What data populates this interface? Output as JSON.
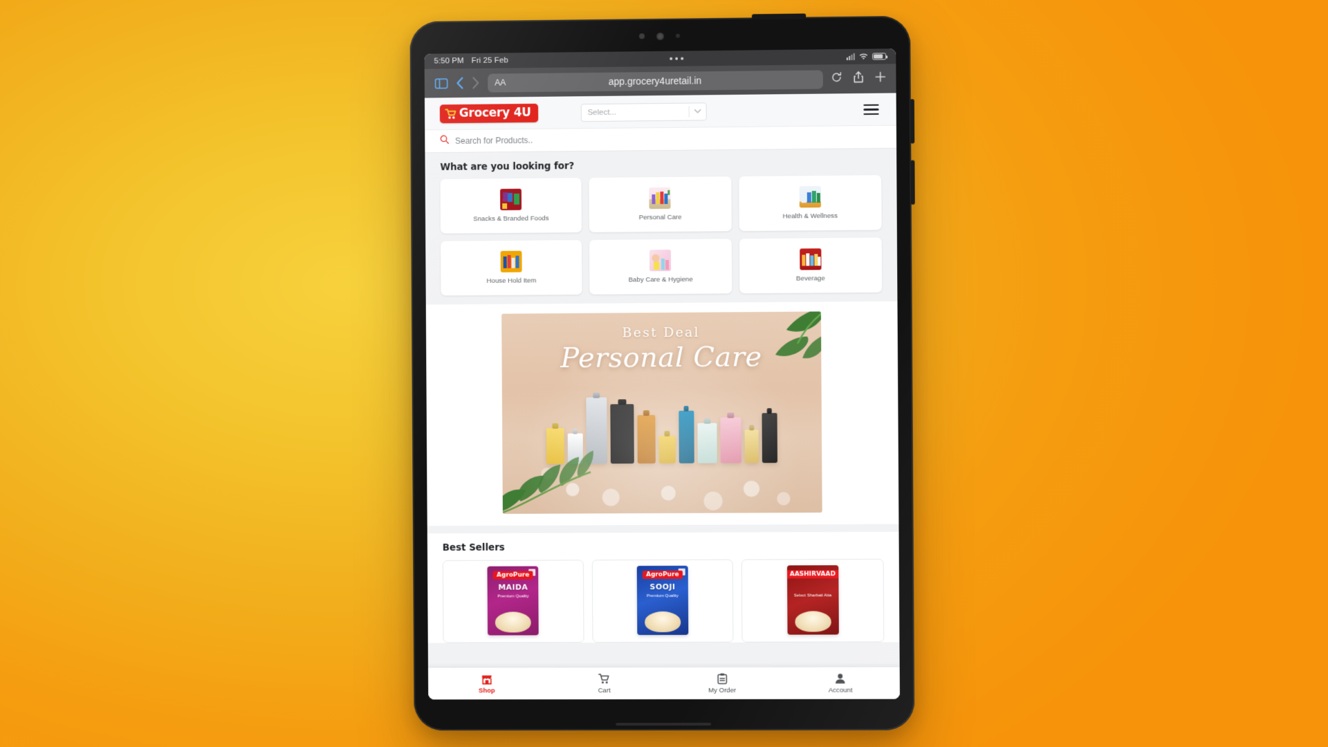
{
  "device": {
    "status_bar": {
      "time": "5:50 PM",
      "date": "Fri 25 Feb",
      "wifi_icon": "wifi-icon",
      "battery_icon": "battery-icon"
    },
    "browser": {
      "sidebar_icon": "sidebar-icon",
      "back_icon": "chevron-left-icon",
      "forward_icon": "chevron-right-icon",
      "reader_label": "AA",
      "url": "app.grocery4uretail.in",
      "reload_icon": "reload-icon",
      "share_icon": "share-icon",
      "new_tab_icon": "plus-icon"
    }
  },
  "app": {
    "header": {
      "logo_text": "Grocery 4U",
      "logo_color": "#e01f18",
      "store_select_value": "Select...",
      "menu_icon": "hamburger-menu-icon"
    },
    "search": {
      "placeholder": "Search for Products..",
      "icon": "search-icon",
      "value": ""
    },
    "categories": {
      "title": "What are you looking for?",
      "items": [
        {
          "label": "Snacks & Branded Foods",
          "thumb": "thumb-snacks"
        },
        {
          "label": "Personal Care",
          "thumb": "thumb-personal"
        },
        {
          "label": "Health & Wellness",
          "thumb": "thumb-health"
        },
        {
          "label": "House Hold Item",
          "thumb": "thumb-house"
        },
        {
          "label": "Baby Care & Hygiene",
          "thumb": "thumb-baby"
        },
        {
          "label": "Beverage",
          "thumb": "thumb-bev"
        }
      ]
    },
    "banner": {
      "eyebrow": "Best Deal",
      "headline": "Personal Care"
    },
    "best_sellers": {
      "title": "Best Sellers",
      "products": [
        {
          "brand": "AgroPure",
          "name": "MAIDA",
          "tagline": "Premium Quality",
          "pack_class": "maida"
        },
        {
          "brand": "AgroPure",
          "name": "SOOJI",
          "tagline": "Premium Quality",
          "pack_class": "sooji"
        },
        {
          "brand": "AASHIRVAAD",
          "name": "",
          "tagline": "Select Sharbati Atta",
          "pack_class": "atta"
        }
      ]
    },
    "tabbar": {
      "items": [
        {
          "label": "Shop",
          "icon": "store-icon",
          "active": true
        },
        {
          "label": "Cart",
          "icon": "cart-icon",
          "active": false
        },
        {
          "label": "My Order",
          "icon": "clipboard-icon",
          "active": false
        },
        {
          "label": "Account",
          "icon": "person-icon",
          "active": false
        }
      ]
    }
  }
}
